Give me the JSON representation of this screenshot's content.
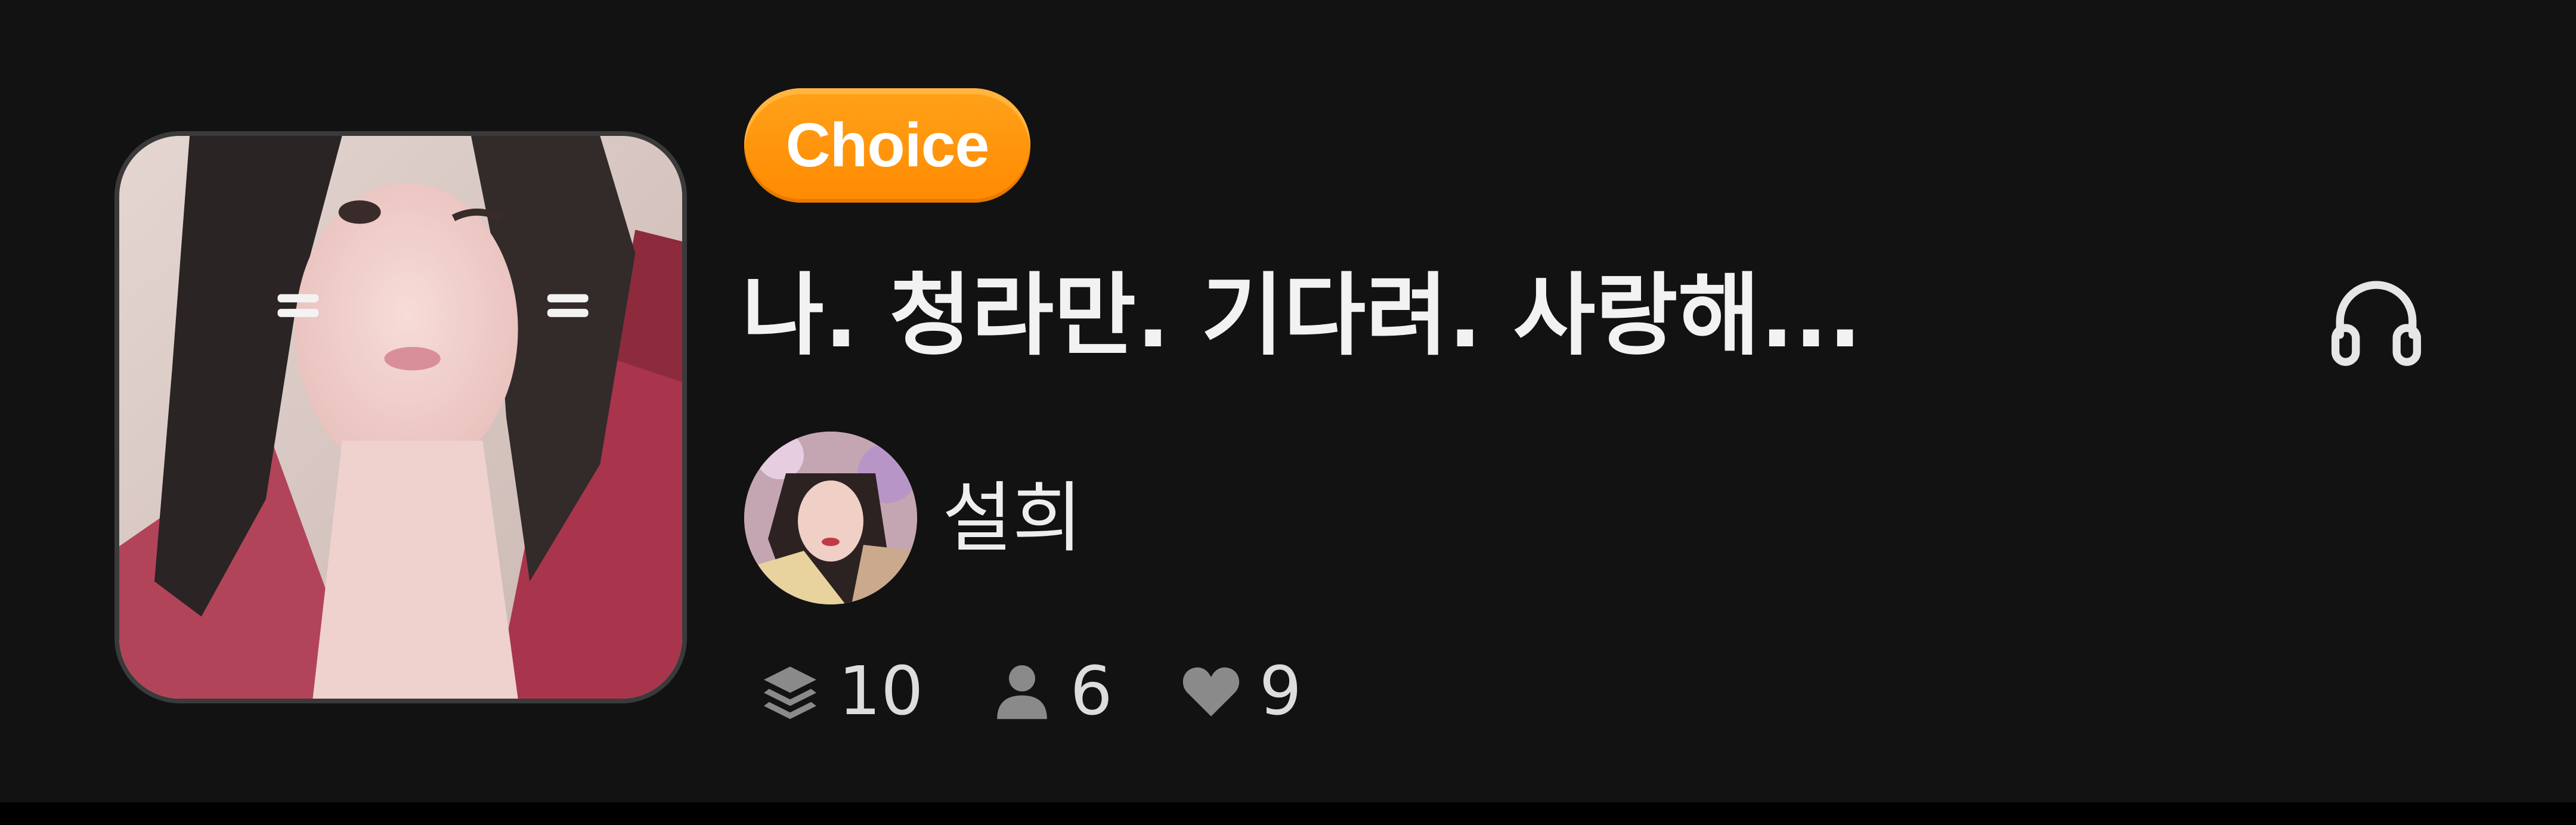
{
  "badge": {
    "label": "Choice"
  },
  "title": "나. 청라만. 기다려. 사랑해...",
  "creator": {
    "name": "설희"
  },
  "stats": {
    "episodes": "10",
    "users": "6",
    "likes": "9"
  },
  "icons": {
    "headphone": "headphone-icon",
    "layers": "layers-icon",
    "user": "user-icon",
    "heart": "heart-icon"
  },
  "colors": {
    "background": "#121212",
    "badge": "#ff9500",
    "text": "#f2f2f2",
    "icon": "#8a8a8a"
  }
}
